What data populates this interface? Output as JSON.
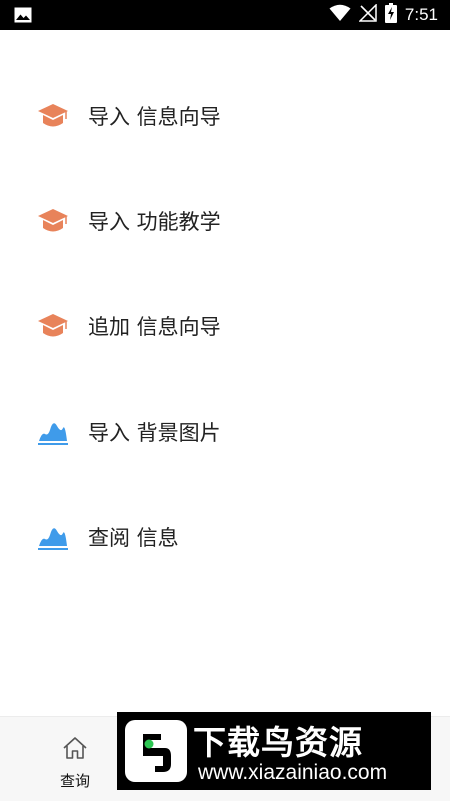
{
  "status_bar": {
    "time": "7:51",
    "icons": [
      "gallery-icon",
      "wifi-icon",
      "no-signal-icon",
      "battery-charging-icon"
    ]
  },
  "menu": {
    "items": [
      {
        "label": "导入 信息向导",
        "icon": "graduation-cap-icon"
      },
      {
        "label": "导入 功能教学",
        "icon": "graduation-cap-icon"
      },
      {
        "label": "追加 信息向导",
        "icon": "graduation-cap-icon"
      },
      {
        "label": "导入 背景图片",
        "icon": "mountain-chart-icon"
      },
      {
        "label": "查阅 信息",
        "icon": "mountain-chart-icon"
      }
    ]
  },
  "bottom_nav": {
    "query_label": "查询",
    "query_icon": "home-icon"
  },
  "watermark": {
    "title": "下载鸟资源",
    "url": "www.xiazainiao.com"
  },
  "colors": {
    "cap_orange": "#E8835A",
    "mountain_blue": "#3F9BEA",
    "status_bar": "#000000",
    "nav_bg": "#F7F7F7"
  }
}
